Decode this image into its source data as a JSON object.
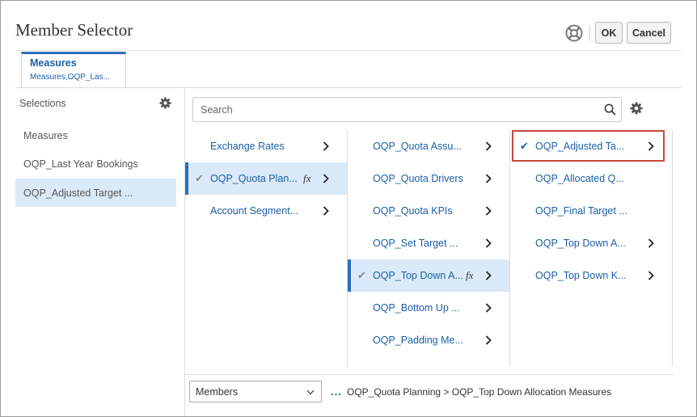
{
  "dialog": {
    "title": "Member Selector",
    "help_icon": "help-lifebuoy-icon",
    "ok_label": "OK",
    "cancel_label": "Cancel"
  },
  "tab": {
    "title": "Measures",
    "subtitle": "Measures,OQP_Las..."
  },
  "selections": {
    "header": "Selections",
    "gear_icon": "gear-icon",
    "items": [
      {
        "label": "Measures",
        "active": false
      },
      {
        "label": "OQP_Last Year Bookings",
        "active": false
      },
      {
        "label": "OQP_Adjusted Target ...",
        "active": true
      }
    ]
  },
  "search": {
    "placeholder": "Search",
    "icon": "search-icon",
    "gear_icon": "gear-icon"
  },
  "columns": [
    {
      "items": [
        {
          "label": "Exchange Rates",
          "checked": false,
          "fx": false,
          "chevron": true,
          "active": false
        },
        {
          "label": "OQP_Quota Plan...",
          "checked": true,
          "fx": true,
          "chevron": true,
          "active": true
        },
        {
          "label": "Account Segment...",
          "checked": false,
          "fx": false,
          "chevron": true,
          "active": false
        }
      ]
    },
    {
      "items": [
        {
          "label": "OQP_Quota Assu...",
          "checked": false,
          "fx": false,
          "chevron": true,
          "active": false
        },
        {
          "label": "OQP_Quota Drivers",
          "checked": false,
          "fx": false,
          "chevron": true,
          "active": false
        },
        {
          "label": "OQP_Quota KPIs",
          "checked": false,
          "fx": false,
          "chevron": true,
          "active": false
        },
        {
          "label": "OQP_Set Target ...",
          "checked": false,
          "fx": false,
          "chevron": true,
          "active": false
        },
        {
          "label": "OQP_Top Down A...",
          "checked": true,
          "fx": true,
          "chevron": true,
          "active": true
        },
        {
          "label": "OQP_Bottom Up ...",
          "checked": false,
          "fx": false,
          "chevron": true,
          "active": false
        },
        {
          "label": "OQP_Padding Me...",
          "checked": false,
          "fx": false,
          "chevron": true,
          "active": false
        }
      ]
    },
    {
      "items": [
        {
          "label": "OQP_Adjusted Ta...",
          "checked": true,
          "fx": false,
          "chevron": true,
          "active": false,
          "highlighted": true
        },
        {
          "label": "OQP_Allocated Q...",
          "checked": false,
          "fx": false,
          "chevron": false,
          "active": false
        },
        {
          "label": "OQP_Final Target ...",
          "checked": false,
          "fx": false,
          "chevron": false,
          "active": false
        },
        {
          "label": "OQP_Top Down A...",
          "checked": false,
          "fx": false,
          "chevron": true,
          "active": false
        },
        {
          "label": "OQP_Top Down K...",
          "checked": false,
          "fx": false,
          "chevron": true,
          "active": false
        }
      ]
    }
  ],
  "glyphs": {
    "check": "✔",
    "fx": "fx",
    "ellipsis": "..."
  },
  "footer": {
    "dropdown_value": "Members",
    "breadcrumb": "OQP_Quota Planning > OQP_Top Down Allocation Measures"
  },
  "colors": {
    "accent": "#1a5fa8",
    "selection_bg": "#dbeaf8",
    "highlight_border": "#c7473d"
  }
}
